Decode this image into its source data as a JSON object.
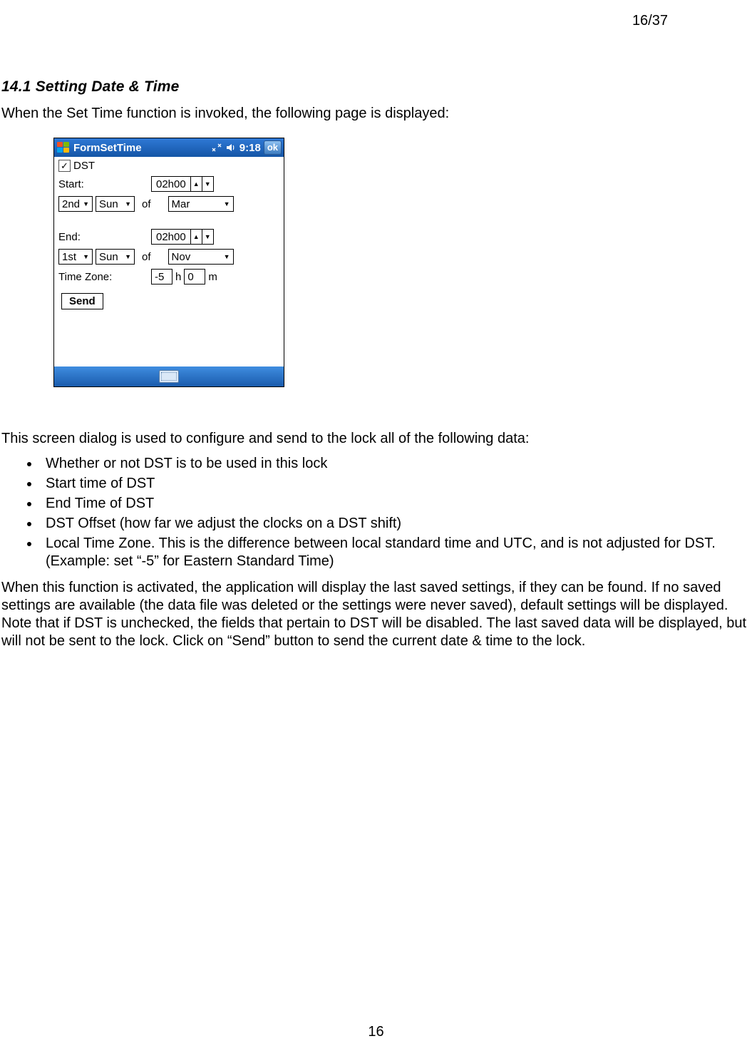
{
  "page": {
    "top_page_number": "16/37",
    "bottom_page_number": "16"
  },
  "heading": "14.1  Setting Date & Time",
  "intro": "When the Set Time function is invoked, the following page is displayed:",
  "titlebar": {
    "title": "FormSetTime",
    "time": "9:18",
    "ok": "ok"
  },
  "form": {
    "dst_label": "DST",
    "dst_checked": true,
    "start_label": "Start:",
    "start_time": "02h00",
    "start_ordinal": "2nd",
    "start_day": "Sun",
    "start_of": "of",
    "start_month": "Mar",
    "end_label": "End:",
    "end_time": "02h00",
    "end_ordinal": "1st",
    "end_day": "Sun",
    "end_of": "of",
    "end_month": "Nov",
    "tz_label": "Time Zone:",
    "tz_h_value": "-5",
    "tz_h_unit": "h",
    "tz_m_value": "0",
    "tz_m_unit": "m",
    "send_label": "Send"
  },
  "para2": "This screen dialog is used to configure and send to the lock all of the following data:",
  "bullets": [
    "Whether or not DST is to be used in this lock",
    "Start time of DST",
    "End Time of DST",
    "DST Offset (how far we adjust the clocks on a DST shift)",
    "Local Time Zone. This is the difference between local standard time and UTC, and is not adjusted for DST.(Example: set “-5” for Eastern Standard Time)"
  ],
  "closing": "When this function is activated, the application will display the last saved settings, if they can be found. If no saved settings are available (the data file was deleted or the settings were never saved), default settings will be displayed. Note that if DST is unchecked, the fields that pertain to DST will be disabled. The last saved data will be displayed, but will not be sent to the lock. Click on “Send” button to send the current date & time to the lock."
}
